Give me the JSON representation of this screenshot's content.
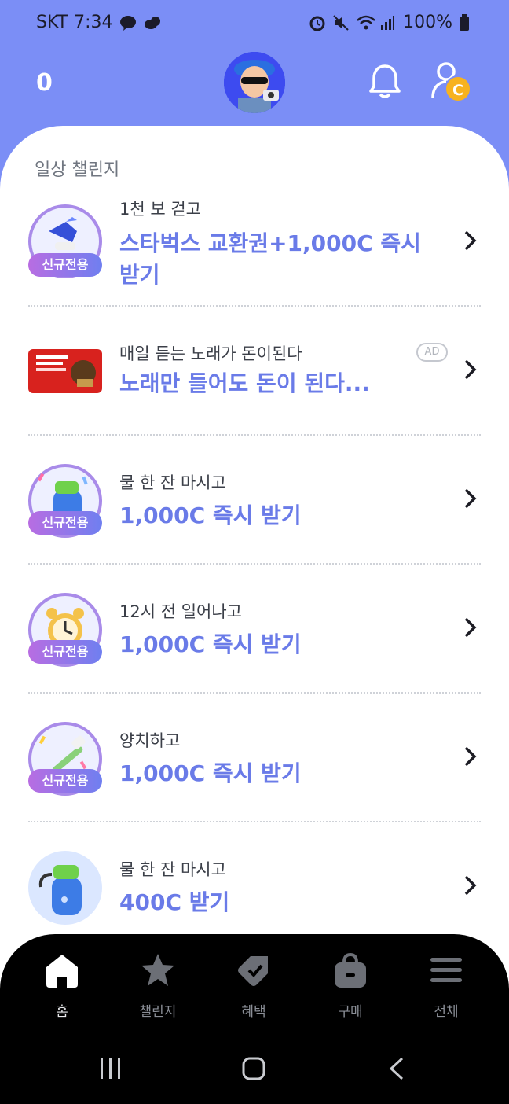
{
  "status_bar": {
    "carrier": "SKT",
    "time": "7:34",
    "battery": "100%"
  },
  "header": {
    "coin_count": "0",
    "badge_letter": "C"
  },
  "section_title": "일상 챌린지",
  "new_badge_label": "신규전용",
  "ad_label": "AD",
  "challenges": [
    {
      "subtitle": "1천 보 걷고",
      "title": "스타벅스 교환권+1,000C 즉시 받기"
    },
    {
      "subtitle": "매일 듣는 노래가 돈이된다",
      "title": "노래만 들어도 돈이 된다..."
    },
    {
      "subtitle": "물 한 잔 마시고",
      "title": "1,000C 즉시 받기"
    },
    {
      "subtitle": "12시 전 일어나고",
      "title": "1,000C 즉시 받기"
    },
    {
      "subtitle": "양치하고",
      "title": "1,000C 즉시 받기"
    },
    {
      "subtitle": "물 한 잔 마시고",
      "title": "400C 받기"
    }
  ],
  "bottom_nav": [
    {
      "label": "홈",
      "icon": "home-icon"
    },
    {
      "label": "챌린지",
      "icon": "star-icon"
    },
    {
      "label": "혜택",
      "icon": "tag-icon"
    },
    {
      "label": "구매",
      "icon": "bag-icon"
    },
    {
      "label": "전체",
      "icon": "menu-icon"
    }
  ],
  "colors": {
    "header_bg": "#7b8ef6",
    "accent_text": "#6a7be8",
    "coin_badge": "#f7b21f"
  }
}
